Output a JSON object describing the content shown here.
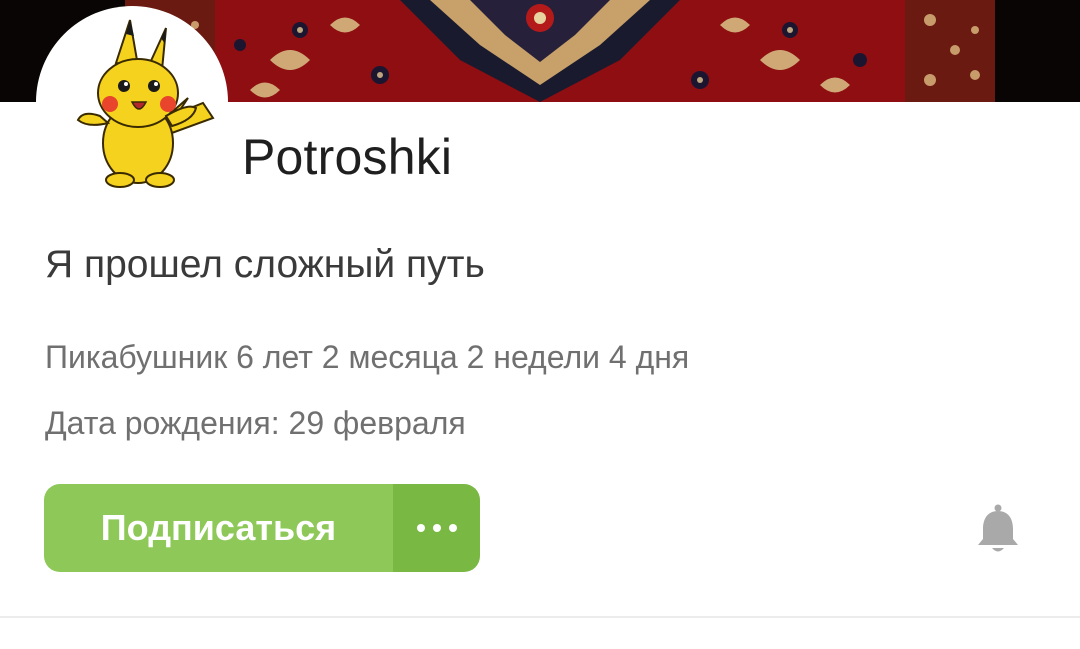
{
  "profile": {
    "username": "Potroshki",
    "status_text": "Я прошел сложный путь",
    "tenure": "Пикабушник 6 лет 2 месяца 2 недели 4 дня",
    "birthday": "Дата рождения: 29 февраля"
  },
  "actions": {
    "subscribe_label": "Подписаться",
    "more_icon": "more-horizontal-icon",
    "notifications_icon": "bell-icon"
  },
  "colors": {
    "subscribe_bg": "#8dc858",
    "more_bg": "#7ab844",
    "carpet_red": "#9e1014",
    "username_text": "#1f1f1f",
    "meta_text": "#707070"
  }
}
